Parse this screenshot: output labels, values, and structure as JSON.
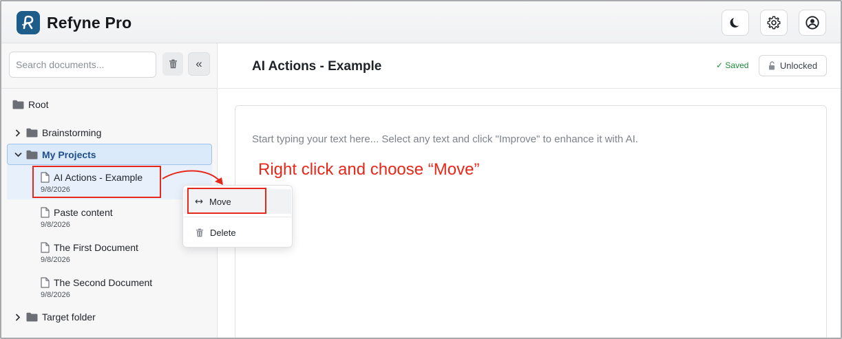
{
  "app": {
    "title": "Refyne Pro"
  },
  "header": {
    "buttons": [
      {
        "name": "dark-mode",
        "icon": "moon-icon"
      },
      {
        "name": "settings",
        "icon": "gear-icon"
      },
      {
        "name": "profile",
        "icon": "user-circle-icon"
      }
    ]
  },
  "sidebar": {
    "search": {
      "placeholder": "Search documents..."
    },
    "collapse_label": "«",
    "tree": {
      "root": "Root",
      "folders": [
        {
          "label": "Brainstorming",
          "expanded": false
        },
        {
          "label": "My Projects",
          "expanded": true
        },
        {
          "label": "Target folder",
          "expanded": false
        }
      ],
      "documents": [
        {
          "title": "AI Actions - Example",
          "date": "9/8/2026"
        },
        {
          "title": "Paste content",
          "date": "9/8/2026"
        },
        {
          "title": "The First Document",
          "date": "9/8/2026"
        },
        {
          "title": "The Second Document",
          "date": "9/8/2026"
        }
      ]
    }
  },
  "context_menu": {
    "move_label": "Move",
    "delete_label": "Delete"
  },
  "main": {
    "title": "AI Actions - Example",
    "saved_status": "✓ Saved",
    "lock_label": "Unlocked",
    "editor_placeholder": "Start typing your text here... Select any text and click \"Improve\" to enhance it with AI."
  },
  "annotation": {
    "text": "Right click and choose “Move”"
  },
  "colors": {
    "brand": "#1e5d8a",
    "selected_folder_bg": "#dbeafb",
    "selected_text": "#1f4e8c",
    "saved_green": "#1b8a3a",
    "annotation_red": "#e8271b"
  }
}
